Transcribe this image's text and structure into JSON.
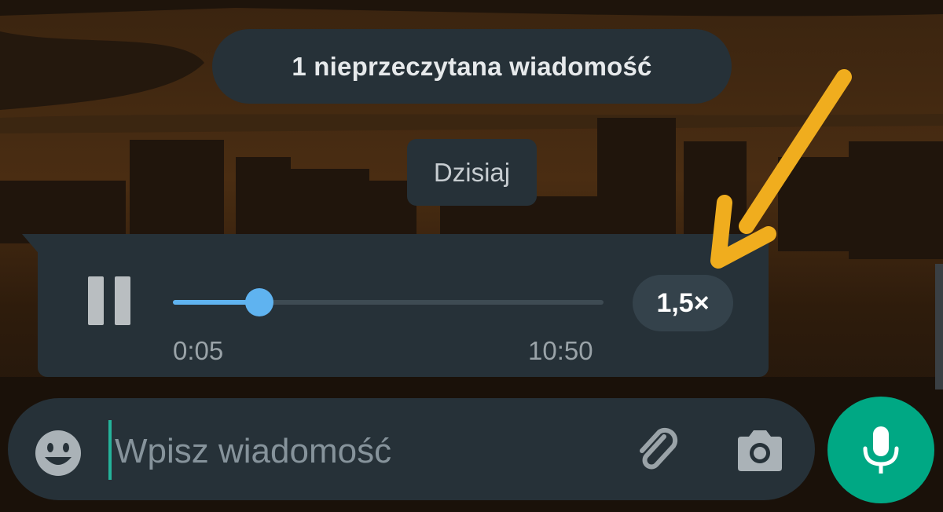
{
  "unread_banner": {
    "text": "1 nieprzeczytana wiadomość"
  },
  "date_chip": {
    "text": "Dzisiaj"
  },
  "voice_message": {
    "elapsed": "0:05",
    "duration": "10:50",
    "progress_fraction": 0.2,
    "speed_label": "1,5×",
    "state": "playing"
  },
  "composer": {
    "placeholder": "Wpisz wiadomość",
    "value": ""
  },
  "icons": {
    "emoji": "emoji-icon",
    "attach": "paperclip-icon",
    "camera": "camera-icon",
    "mic": "microphone-icon",
    "pause": "pause-icon"
  },
  "colors": {
    "bubble": "#263138",
    "accent_blue": "#5fb3f0",
    "accent_green": "#00a884",
    "annotation_arrow": "#f0ad1e"
  }
}
